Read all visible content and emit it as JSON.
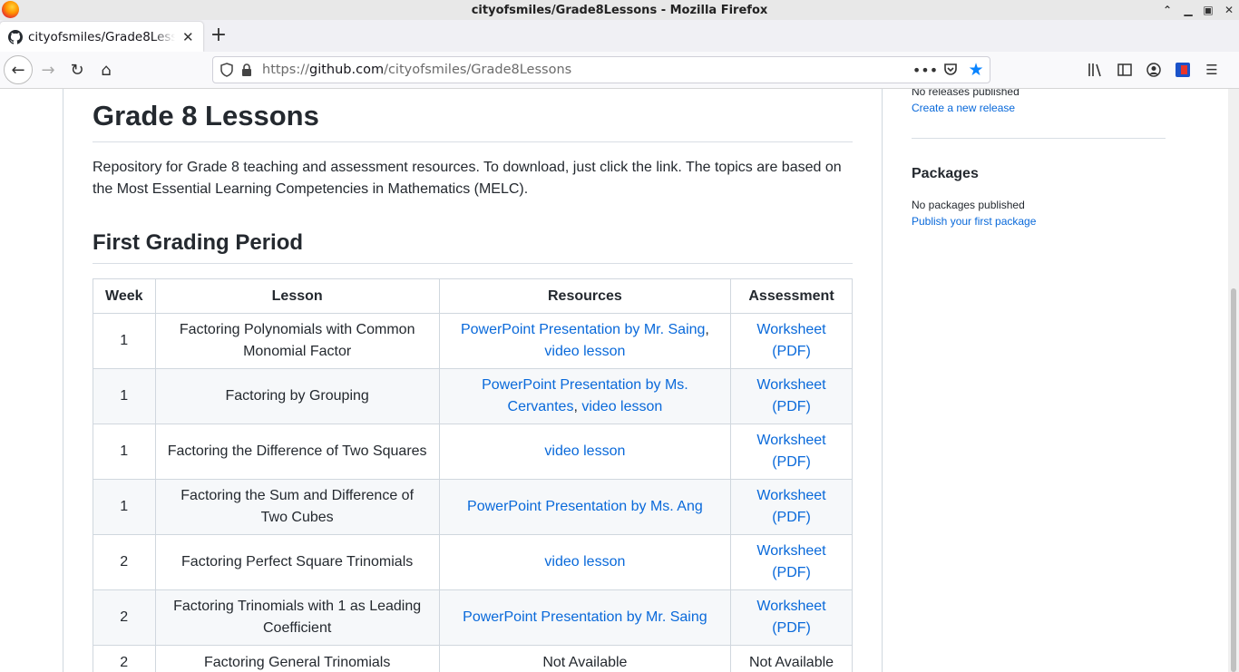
{
  "window": {
    "title": "cityofsmiles/Grade8Lessons - Mozilla Firefox"
  },
  "tab": {
    "label": "cityofsmiles/Grade8Lessons"
  },
  "urlbar": {
    "scheme": "https://",
    "domain": "github.com",
    "path": "/cityofsmiles/Grade8Lessons"
  },
  "readme": {
    "title": "Grade 8 Lessons",
    "description": "Repository for Grade 8 teaching and assessment resources. To download, just click the link. The topics are based on the Most Essential Learning Competencies in Mathematics (MELC).",
    "section_title": "First Grading Period",
    "headers": {
      "week": "Week",
      "lesson": "Lesson",
      "resources": "Resources",
      "assessment": "Assessment"
    },
    "rows": [
      {
        "week": "1",
        "lesson": "Factoring Polynomials with Common Monomial Factor",
        "res1": "PowerPoint Presentation by Mr. Saing",
        "sep": ",",
        "res2": "video lesson",
        "assess": "Worksheet (PDF)"
      },
      {
        "week": "1",
        "lesson": "Factoring by Grouping",
        "res1": "PowerPoint Presentation by Ms. Cervantes",
        "sep": ",",
        "res2": "video lesson",
        "assess": "Worksheet (PDF)"
      },
      {
        "week": "1",
        "lesson": "Factoring the Difference of Two Squares",
        "res1": "video lesson",
        "assess": "Worksheet (PDF)"
      },
      {
        "week": "1",
        "lesson": "Factoring the Sum and Difference of Two Cubes",
        "res1": "PowerPoint Presentation by Ms. Ang",
        "assess": "Worksheet (PDF)"
      },
      {
        "week": "2",
        "lesson": "Factoring Perfect Square Trinomials",
        "res1": "video lesson",
        "assess": "Worksheet (PDF)"
      },
      {
        "week": "2",
        "lesson": "Factoring Trinomials with 1 as Leading Coefficient",
        "res1": "PowerPoint Presentation by Mr. Saing",
        "assess": "Worksheet (PDF)"
      },
      {
        "week": "2",
        "lesson": "Factoring General Trinomials",
        "res_text": "Not Available",
        "assess_text": "Not Available"
      }
    ]
  },
  "sidebar": {
    "releases_status": "No releases published",
    "create_release": "Create a new release",
    "packages_title": "Packages",
    "packages_status": "No packages published",
    "publish_package": "Publish your first package"
  }
}
